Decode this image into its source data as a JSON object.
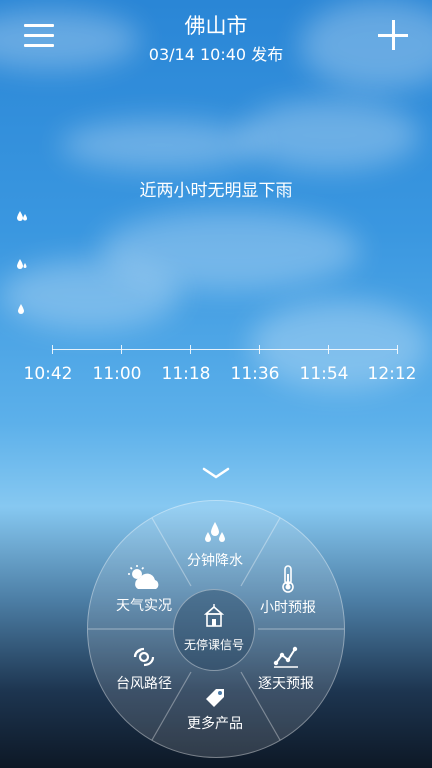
{
  "header": {
    "city": "佛山市",
    "publish_time": "03/14  10:40 发布"
  },
  "precipitation": {
    "title": "近两小时无明显下雨",
    "time_labels": [
      "10:42",
      "11:00",
      "11:18",
      "11:36",
      "11:54",
      "12:12"
    ]
  },
  "wheel": {
    "center_label": "无停课信号",
    "items": [
      {
        "label": "分钟降水"
      },
      {
        "label": "小时预报"
      },
      {
        "label": "逐天预报"
      },
      {
        "label": "更多产品"
      },
      {
        "label": "台风路径"
      },
      {
        "label": "天气实况"
      }
    ]
  }
}
